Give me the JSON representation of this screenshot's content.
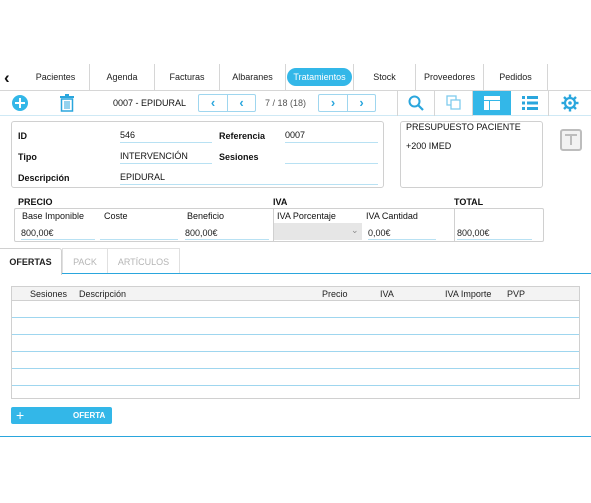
{
  "nav": {
    "tabs": [
      "Pacientes",
      "Agenda",
      "Facturas",
      "Albaranes",
      "Tratamientos",
      "Stock",
      "Proveedores",
      "Pedidos"
    ],
    "active_tab": "Tratamientos"
  },
  "toolbar": {
    "record_title": "0007 - EPIDURAL",
    "record_position": "7 / 18 (18)"
  },
  "form": {
    "id_label": "ID",
    "id_value": "546",
    "referencia_label": "Referencia",
    "referencia_value": "0007",
    "tipo_label": "Tipo",
    "tipo_value": "INTERVENCIÓN",
    "sesiones_label": "Sesiones",
    "sesiones_value": "",
    "descripcion_label": "Descripción",
    "descripcion_value": "EPIDURAL"
  },
  "notes": {
    "line1": "PRESUPUESTO PACIENTE",
    "line2": "+200 IMED"
  },
  "pricing": {
    "precio_label": "PRECIO",
    "iva_label": "IVA",
    "total_label": "TOTAL",
    "base_imponible_label": "Base Imponible",
    "coste_label": "Coste",
    "beneficio_label": "Beneficio",
    "iva_porcentaje_label": "IVA Porcentaje",
    "iva_cantidad_label": "IVA Cantidad",
    "base_imponible_value": "800,00€",
    "coste_value": "",
    "beneficio_value": "800,00€",
    "iva_porcentaje_value": "",
    "iva_cantidad_value": "0,00€",
    "total_value": "800,00€"
  },
  "subtabs": [
    "OFERTAS",
    "PACK",
    "ARTÍCULOS"
  ],
  "table": {
    "columns": [
      "Sesiones",
      "Descripción",
      "Precio",
      "IVA",
      "IVA Importe",
      "PVP"
    ],
    "rows": []
  },
  "add_button_label": "OFERTA",
  "colors": {
    "accent": "#33b7e8",
    "accent_dark": "#2aa6dd"
  }
}
